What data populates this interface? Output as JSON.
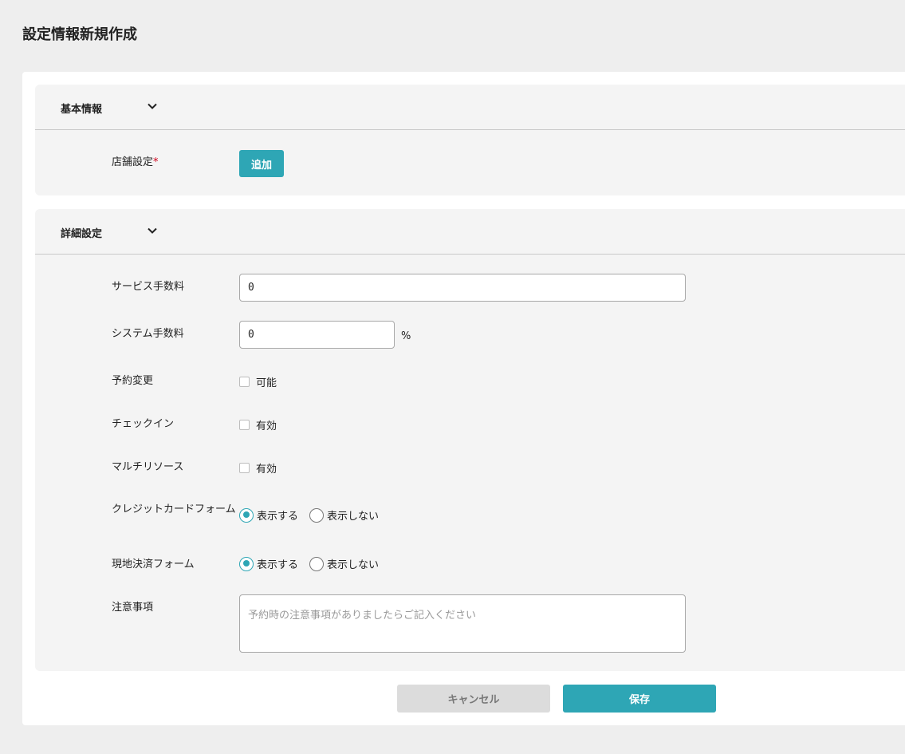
{
  "page": {
    "title": "設定情報新規作成"
  },
  "colors": {
    "accent": "#2ea6b5",
    "required": "#d0021b",
    "cancel_bg": "#dcdcdc"
  },
  "basic": {
    "title": "基本情報",
    "store_label": "店舗設定",
    "required_mark": "*",
    "add_label": "追加"
  },
  "detail": {
    "title": "詳細設定",
    "service_fee": {
      "label": "サービス手数料",
      "value": "0"
    },
    "system_fee": {
      "label": "システム手数料",
      "value": "0",
      "unit": "%"
    },
    "reservation_change": {
      "label": "予約変更",
      "option": "可能",
      "checked": false
    },
    "checkin": {
      "label": "チェックイン",
      "option": "有効",
      "checked": false
    },
    "multi_resource": {
      "label": "マルチリソース",
      "option": "有効",
      "checked": false
    },
    "credit_form": {
      "label": "クレジットカードフォーム",
      "show": "表示する",
      "hide": "表示しない",
      "selected": "show"
    },
    "onsite_form": {
      "label": "現地決済フォーム",
      "show": "表示する",
      "hide": "表示しない",
      "selected": "show"
    },
    "notes": {
      "label": "注意事項",
      "placeholder": "予約時の注意事項がありましたらご記入ください"
    }
  },
  "actions": {
    "cancel": "キャンセル",
    "save": "保存"
  },
  "icons": {
    "collapse": "chevron-down-icon"
  }
}
